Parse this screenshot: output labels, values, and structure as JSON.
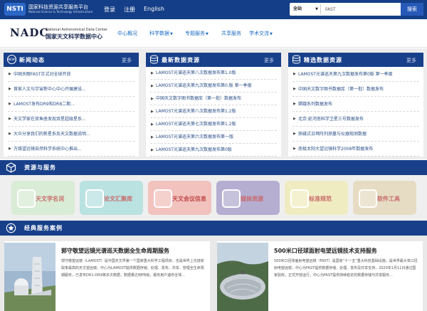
{
  "topbar": {
    "logo_mark": "NSTI",
    "logo_title": "国家科技资源共享服务平台",
    "logo_subtitle": "National Science & Technology Infrastructure",
    "links": [
      "登录",
      "注册",
      "English"
    ],
    "search": {
      "scope": "全站",
      "value": "FAST",
      "button": "搜索"
    }
  },
  "header": {
    "brand_logo": "NADC",
    "brand_en": "National Astronomical Data Center",
    "brand_cn": "国家天文科学数据中心",
    "nav": [
      {
        "label": "中心概况",
        "dropdown": false
      },
      {
        "label": "科学数据",
        "dropdown": true
      },
      {
        "label": "专题服务",
        "dropdown": true
      },
      {
        "label": "共享服务",
        "dropdown": false
      },
      {
        "label": "学术交流",
        "dropdown": true
      }
    ]
  },
  "news": {
    "title": "新闻动态",
    "icon_label": "NEWS",
    "more": "更多",
    "items": [
      "中国天眼FAST正式对全球开放",
      "首家人文与宇宙新中心中心开展建设...",
      "LAMOST发布DR9和DR8二期...",
      "天文学家在双鱼座发现双星超级星系...",
      "大众分享我们的新星系及天文数据说明...",
      "万维望远镜自然科学系统中心推出..."
    ]
  },
  "latest": {
    "title": "最新数据资源",
    "more": "更多",
    "items": [
      "LAMOST光谱巡天第八次数据发布第1.0版",
      "LAMOST光谱巡天第九次数据发布第0.版 第一季度",
      "中国天文数字图书数据库（第一批）数据发布",
      "LAMOST光谱巡天第八次数据发布第1.2版",
      "LAMOST光谱巡天第七次数据发布第1.2版",
      "LAMOST光谱巡天第六次数据发布第一版",
      "LAMOST光谱巡天第九次数据发布第0版"
    ]
  },
  "featured": {
    "title": "精选数据资源",
    "more": "更多",
    "items": [
      "LAMOST光谱巡天第九次数据发布第0版 第一季度",
      "中国天文数字图书数据库（第一批）数据发布",
      "嫦娥系列数据发布",
      "北京·延河南科学卫星三号数据发布",
      "狭缝式日珥阵列测量与仪器观测数据",
      "南极太阳大望远镜科学2008年数据发布"
    ]
  },
  "resources": {
    "title": "资源与服务",
    "tiles": [
      {
        "label": "天文学名词",
        "color": "#d9ecd5",
        "text_color": "#c85f5f"
      },
      {
        "label": "论文汇聚库",
        "color": "#b9e2e1",
        "text_color": "#c85f5f"
      },
      {
        "label": "天文会议信息",
        "color": "#f2c2be",
        "text_color": "#c04848"
      },
      {
        "label": "媒体资源",
        "color": "#b5aed1",
        "text_color": "#c85f5f"
      },
      {
        "label": "标准规范",
        "color": "#f0ecc1",
        "text_color": "#c85f5f"
      },
      {
        "label": "软件工具",
        "color": "#e5dcc3",
        "text_color": "#c85f5f"
      }
    ]
  },
  "cases": {
    "title": "经典服务案例",
    "items": [
      {
        "title": "郭守敬望远镜光谱巡天数据全生命周期服务",
        "body": "郭守敬望远镜（LAMOST）是中国天文界第一个国家重大科学工程项目，也是世界上光谱获取率最高的天文望远镜，中心为LAMOST提供数据存储、处理、发布、共享、管理全生命周期服务，已发布DR1-DR9等多次数据，数据量达到PB级，服务用户遍布全球..."
      },
      {
        "title": "500米口径球面射电望远镜技术支持服务",
        "body": "500米口径球面射电望远镜（FAST）是国家“十一五”重大科技基础设施，是世界最大单口径射电望远镜，中心为FAST提供数据存储、处理、发布及共享支持，2020年1月11日通过国家验收，正式开放运行，中心为FAST提供持续稳定的数据存储与共享服务..."
      }
    ]
  }
}
